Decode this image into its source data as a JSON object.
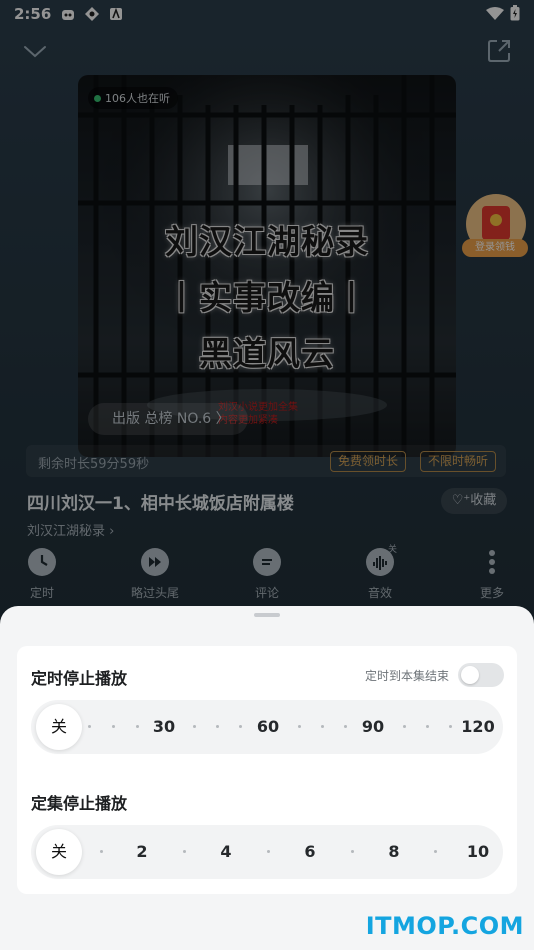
{
  "status_bar": {
    "time": "2:56"
  },
  "cover": {
    "listeners": "106人也在听",
    "title_lines": [
      "刘汉江湖秘录",
      "丨实事改编丨",
      "黑道风云"
    ],
    "note_lines": [
      "刘汉小说更加全集",
      "内容更加紧凑"
    ],
    "rank": "出版 总榜 NO.6 〉"
  },
  "promo": {
    "label": "登录领钱"
  },
  "remain": {
    "text": "剩余时长59分59秒",
    "tag1": "免费领时长",
    "tag2": "不限时畅听"
  },
  "episode": {
    "title": "四川刘汉一1、相中长城饭店附属楼",
    "favorite": "♡⁺收藏",
    "album": "刘汉江湖秘录 ›"
  },
  "controls": [
    {
      "label": "定时",
      "icon": "clock-icon"
    },
    {
      "label": "略过头尾",
      "icon": "skip-icon"
    },
    {
      "label": "评论",
      "icon": "comment-icon"
    },
    {
      "label": "音效",
      "icon": "sound-effect-icon",
      "badge": "关"
    },
    {
      "label": "更多",
      "icon": "more-icon"
    }
  ],
  "sheet": {
    "timer_title": "定时停止播放",
    "episode_end_label": "定时到本集结束",
    "episode_end_on": false,
    "timer_options": [
      "关",
      "30",
      "60",
      "90",
      "120"
    ],
    "episodes_title": "定集停止播放",
    "episode_options": [
      "关",
      "2",
      "4",
      "6",
      "8",
      "10"
    ],
    "selected_timer": "关",
    "selected_episodes": "关"
  },
  "watermark": "ITMOP.COM",
  "colors": {
    "accent_gold": "#d7a456",
    "watermark": "#14a5e0",
    "sheet_bg": "#f4f5f6"
  }
}
